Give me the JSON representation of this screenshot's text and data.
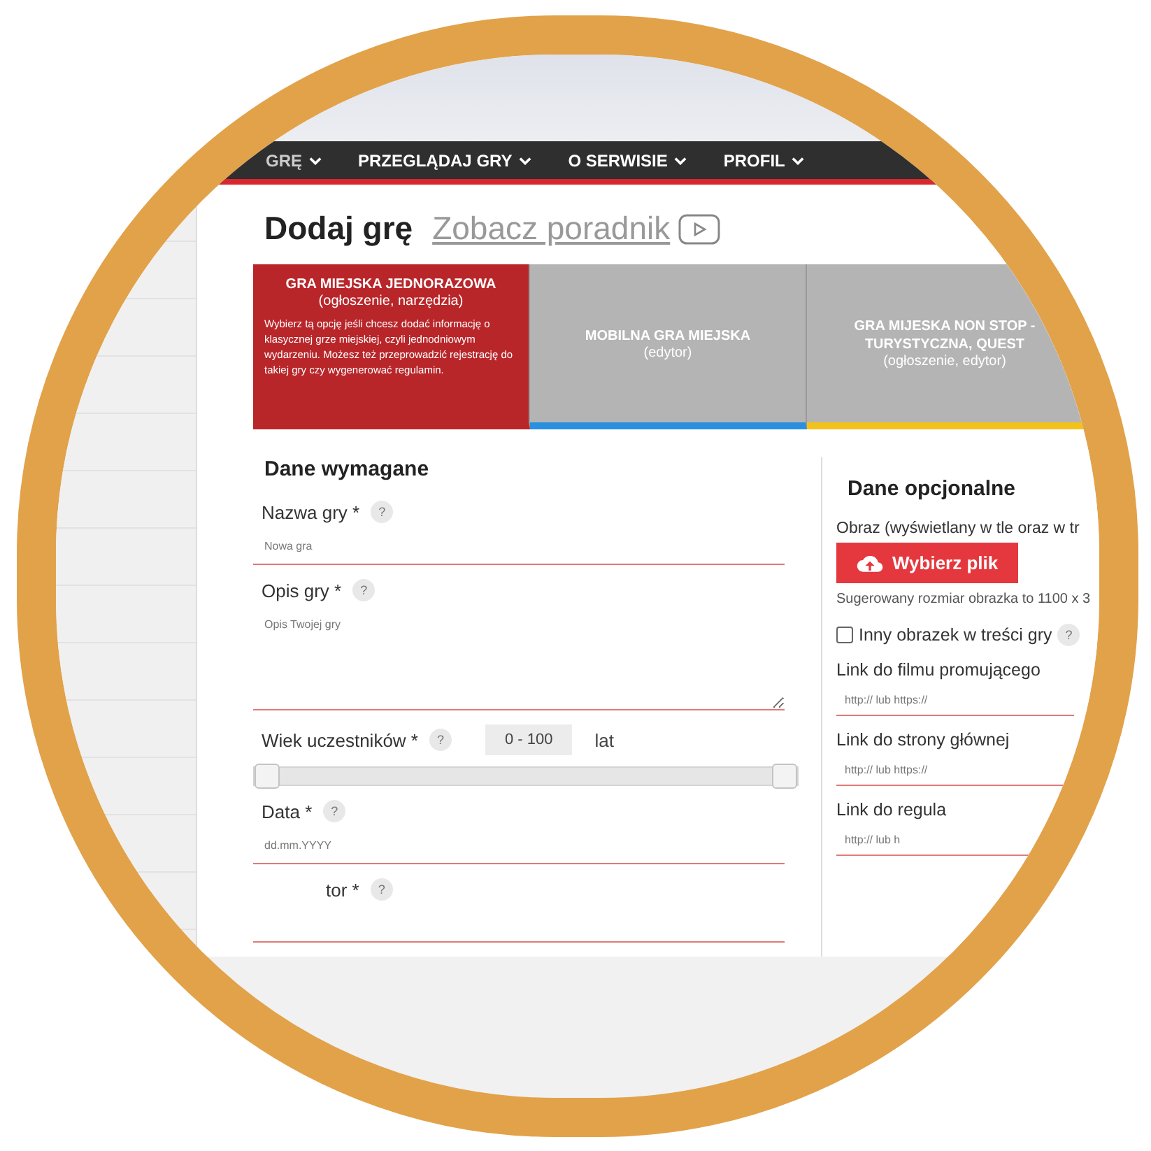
{
  "nav": {
    "items": [
      {
        "label": "GRĘ"
      },
      {
        "label": "PRZEGLĄDAJ GRY"
      },
      {
        "label": "O SERWISIE"
      },
      {
        "label": "PROFIL"
      }
    ]
  },
  "header": {
    "title": "Dodaj grę",
    "tutorial_link": "Zobacz poradnik"
  },
  "game_types": [
    {
      "title": "GRA MIEJSKA JEDNORAZOWA",
      "subtitle": "(ogłoszenie, narzędzia)",
      "description": "Wybierz tą opcję jeśli chcesz dodać informację o klasycznej grze miejskiej, czyli jednodniowym wydarzeniu. Możesz też przeprowadzić rejestrację do takiej gry czy wygenerować regulamin.",
      "selected": true
    },
    {
      "title": "MOBILNA GRA MIEJSKA",
      "subtitle": "(edytor)",
      "selected": false,
      "color": "#2b8fe0"
    },
    {
      "title": "GRA MIJESKA NON STOP - TURYSTYCZNA, QUEST",
      "subtitle": "(ogłoszenie, edytor)",
      "selected": false,
      "color": "#f2c21b"
    }
  ],
  "required": {
    "title": "Dane wymagane",
    "fields": [
      {
        "kind": "text",
        "label": "Nazwa gry *",
        "help": "?",
        "placeholder": "Nowa gra"
      },
      {
        "kind": "textarea",
        "label": "Opis gry *",
        "help": "?",
        "placeholder": "Opis Twojej gry"
      },
      {
        "kind": "range",
        "label": "Wiek uczestników *",
        "help": "?",
        "value": "0 - 100",
        "unit": "lat",
        "thumbs": [
          {
            "level": 0
          },
          {
            "level": 1
          }
        ]
      },
      {
        "kind": "text",
        "label": "Data *",
        "help": "?",
        "placeholder": "dd.mm.YYYY"
      },
      {
        "kind": "text",
        "label": "tor *",
        "help": "?"
      }
    ]
  },
  "optional": {
    "title": "Dane opcjonalne",
    "image_label": "Obraz (wyświetlany w tle oraz w tr",
    "upload_button": "Wybierz plik",
    "image_hint": "Sugerowany rozmiar obrazka to 1100 x 3",
    "checkbox": {
      "label": "Inny obrazek w treści gry",
      "help": "?",
      "checked": false
    },
    "links": [
      {
        "label": "Link do filmu promującego",
        "placeholder": "http:// lub https://"
      },
      {
        "label": "Link do strony głównej",
        "placeholder": "http:// lub https://"
      },
      {
        "label": "Link do regula",
        "placeholder": "http:// lub h"
      }
    ]
  }
}
